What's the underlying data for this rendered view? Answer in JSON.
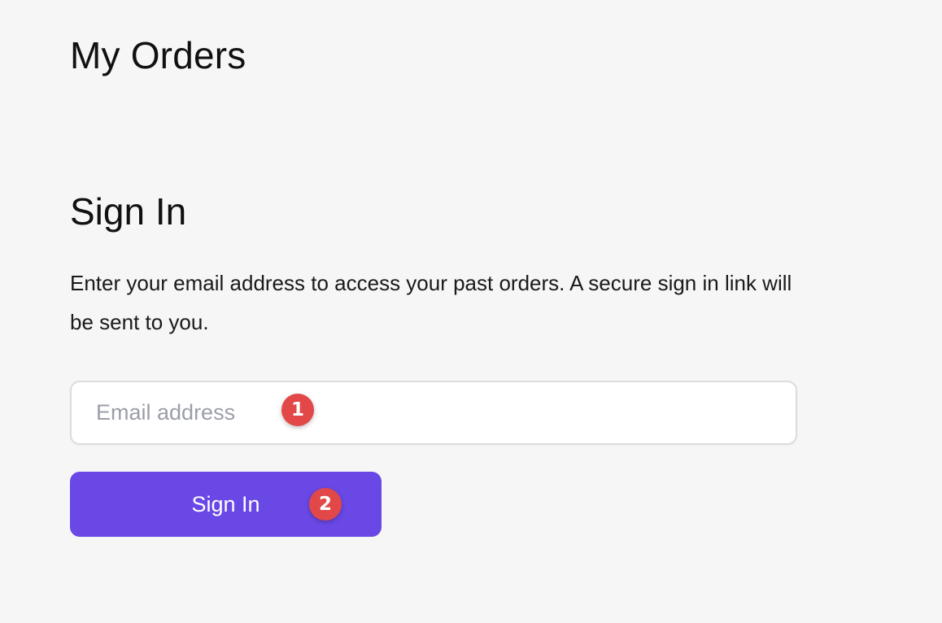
{
  "header": {
    "title": "My Orders"
  },
  "signin": {
    "title": "Sign In",
    "description": "Enter your email address to access your past orders. A secure sign in link will be sent to you.",
    "email_placeholder": "Email address",
    "email_value": "",
    "button_label": "Sign In"
  },
  "markers": [
    "1",
    "2"
  ],
  "colors": {
    "background": "#f6f6f6",
    "button": "#6a48e6",
    "marker": "#e24848",
    "placeholder": "#9b9ea8"
  }
}
